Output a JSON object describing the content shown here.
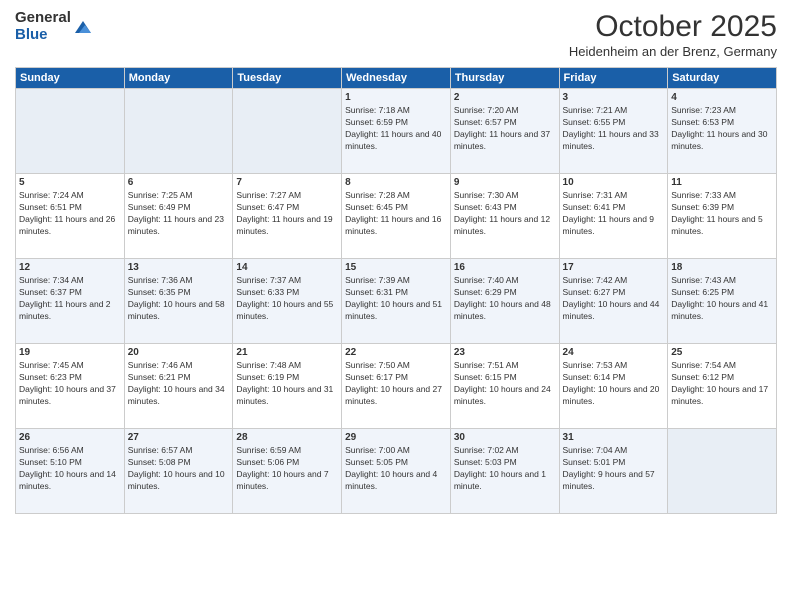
{
  "logo": {
    "general": "General",
    "blue": "Blue"
  },
  "header": {
    "month": "October 2025",
    "location": "Heidenheim an der Brenz, Germany"
  },
  "days_of_week": [
    "Sunday",
    "Monday",
    "Tuesday",
    "Wednesday",
    "Thursday",
    "Friday",
    "Saturday"
  ],
  "weeks": [
    [
      {
        "day": "",
        "sunrise": "",
        "sunset": "",
        "daylight": "",
        "empty": true
      },
      {
        "day": "",
        "sunrise": "",
        "sunset": "",
        "daylight": "",
        "empty": true
      },
      {
        "day": "",
        "sunrise": "",
        "sunset": "",
        "daylight": "",
        "empty": true
      },
      {
        "day": "1",
        "sunrise": "Sunrise: 7:18 AM",
        "sunset": "Sunset: 6:59 PM",
        "daylight": "Daylight: 11 hours and 40 minutes."
      },
      {
        "day": "2",
        "sunrise": "Sunrise: 7:20 AM",
        "sunset": "Sunset: 6:57 PM",
        "daylight": "Daylight: 11 hours and 37 minutes."
      },
      {
        "day": "3",
        "sunrise": "Sunrise: 7:21 AM",
        "sunset": "Sunset: 6:55 PM",
        "daylight": "Daylight: 11 hours and 33 minutes."
      },
      {
        "day": "4",
        "sunrise": "Sunrise: 7:23 AM",
        "sunset": "Sunset: 6:53 PM",
        "daylight": "Daylight: 11 hours and 30 minutes."
      }
    ],
    [
      {
        "day": "5",
        "sunrise": "Sunrise: 7:24 AM",
        "sunset": "Sunset: 6:51 PM",
        "daylight": "Daylight: 11 hours and 26 minutes."
      },
      {
        "day": "6",
        "sunrise": "Sunrise: 7:25 AM",
        "sunset": "Sunset: 6:49 PM",
        "daylight": "Daylight: 11 hours and 23 minutes."
      },
      {
        "day": "7",
        "sunrise": "Sunrise: 7:27 AM",
        "sunset": "Sunset: 6:47 PM",
        "daylight": "Daylight: 11 hours and 19 minutes."
      },
      {
        "day": "8",
        "sunrise": "Sunrise: 7:28 AM",
        "sunset": "Sunset: 6:45 PM",
        "daylight": "Daylight: 11 hours and 16 minutes."
      },
      {
        "day": "9",
        "sunrise": "Sunrise: 7:30 AM",
        "sunset": "Sunset: 6:43 PM",
        "daylight": "Daylight: 11 hours and 12 minutes."
      },
      {
        "day": "10",
        "sunrise": "Sunrise: 7:31 AM",
        "sunset": "Sunset: 6:41 PM",
        "daylight": "Daylight: 11 hours and 9 minutes."
      },
      {
        "day": "11",
        "sunrise": "Sunrise: 7:33 AM",
        "sunset": "Sunset: 6:39 PM",
        "daylight": "Daylight: 11 hours and 5 minutes."
      }
    ],
    [
      {
        "day": "12",
        "sunrise": "Sunrise: 7:34 AM",
        "sunset": "Sunset: 6:37 PM",
        "daylight": "Daylight: 11 hours and 2 minutes."
      },
      {
        "day": "13",
        "sunrise": "Sunrise: 7:36 AM",
        "sunset": "Sunset: 6:35 PM",
        "daylight": "Daylight: 10 hours and 58 minutes."
      },
      {
        "day": "14",
        "sunrise": "Sunrise: 7:37 AM",
        "sunset": "Sunset: 6:33 PM",
        "daylight": "Daylight: 10 hours and 55 minutes."
      },
      {
        "day": "15",
        "sunrise": "Sunrise: 7:39 AM",
        "sunset": "Sunset: 6:31 PM",
        "daylight": "Daylight: 10 hours and 51 minutes."
      },
      {
        "day": "16",
        "sunrise": "Sunrise: 7:40 AM",
        "sunset": "Sunset: 6:29 PM",
        "daylight": "Daylight: 10 hours and 48 minutes."
      },
      {
        "day": "17",
        "sunrise": "Sunrise: 7:42 AM",
        "sunset": "Sunset: 6:27 PM",
        "daylight": "Daylight: 10 hours and 44 minutes."
      },
      {
        "day": "18",
        "sunrise": "Sunrise: 7:43 AM",
        "sunset": "Sunset: 6:25 PM",
        "daylight": "Daylight: 10 hours and 41 minutes."
      }
    ],
    [
      {
        "day": "19",
        "sunrise": "Sunrise: 7:45 AM",
        "sunset": "Sunset: 6:23 PM",
        "daylight": "Daylight: 10 hours and 37 minutes."
      },
      {
        "day": "20",
        "sunrise": "Sunrise: 7:46 AM",
        "sunset": "Sunset: 6:21 PM",
        "daylight": "Daylight: 10 hours and 34 minutes."
      },
      {
        "day": "21",
        "sunrise": "Sunrise: 7:48 AM",
        "sunset": "Sunset: 6:19 PM",
        "daylight": "Daylight: 10 hours and 31 minutes."
      },
      {
        "day": "22",
        "sunrise": "Sunrise: 7:50 AM",
        "sunset": "Sunset: 6:17 PM",
        "daylight": "Daylight: 10 hours and 27 minutes."
      },
      {
        "day": "23",
        "sunrise": "Sunrise: 7:51 AM",
        "sunset": "Sunset: 6:15 PM",
        "daylight": "Daylight: 10 hours and 24 minutes."
      },
      {
        "day": "24",
        "sunrise": "Sunrise: 7:53 AM",
        "sunset": "Sunset: 6:14 PM",
        "daylight": "Daylight: 10 hours and 20 minutes."
      },
      {
        "day": "25",
        "sunrise": "Sunrise: 7:54 AM",
        "sunset": "Sunset: 6:12 PM",
        "daylight": "Daylight: 10 hours and 17 minutes."
      }
    ],
    [
      {
        "day": "26",
        "sunrise": "Sunrise: 6:56 AM",
        "sunset": "Sunset: 5:10 PM",
        "daylight": "Daylight: 10 hours and 14 minutes."
      },
      {
        "day": "27",
        "sunrise": "Sunrise: 6:57 AM",
        "sunset": "Sunset: 5:08 PM",
        "daylight": "Daylight: 10 hours and 10 minutes."
      },
      {
        "day": "28",
        "sunrise": "Sunrise: 6:59 AM",
        "sunset": "Sunset: 5:06 PM",
        "daylight": "Daylight: 10 hours and 7 minutes."
      },
      {
        "day": "29",
        "sunrise": "Sunrise: 7:00 AM",
        "sunset": "Sunset: 5:05 PM",
        "daylight": "Daylight: 10 hours and 4 minutes."
      },
      {
        "day": "30",
        "sunrise": "Sunrise: 7:02 AM",
        "sunset": "Sunset: 5:03 PM",
        "daylight": "Daylight: 10 hours and 1 minute."
      },
      {
        "day": "31",
        "sunrise": "Sunrise: 7:04 AM",
        "sunset": "Sunset: 5:01 PM",
        "daylight": "Daylight: 9 hours and 57 minutes."
      },
      {
        "day": "",
        "sunrise": "",
        "sunset": "",
        "daylight": "",
        "empty": true
      }
    ]
  ]
}
